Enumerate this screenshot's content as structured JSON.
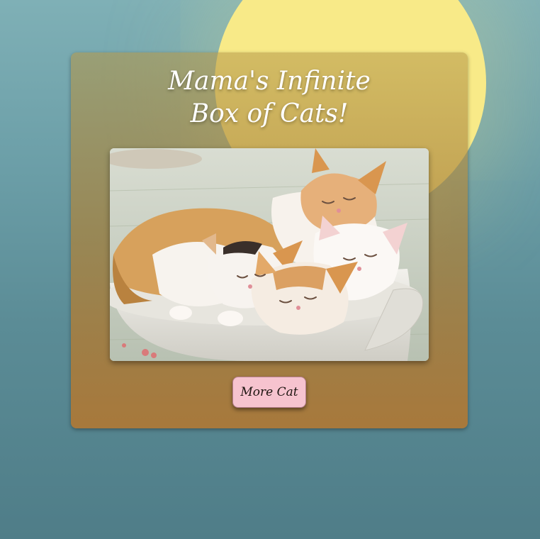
{
  "page": {
    "title_line1": "Mama's Infinite",
    "title_line2": "Box of Cats!",
    "more_button_label": "More Cat"
  },
  "photo": {
    "alt": "Five kittens sleeping in a white bowl"
  },
  "colors": {
    "sun": "#f8ea88",
    "button": "#f6c3cf",
    "card_bottom": "#ac7837"
  }
}
